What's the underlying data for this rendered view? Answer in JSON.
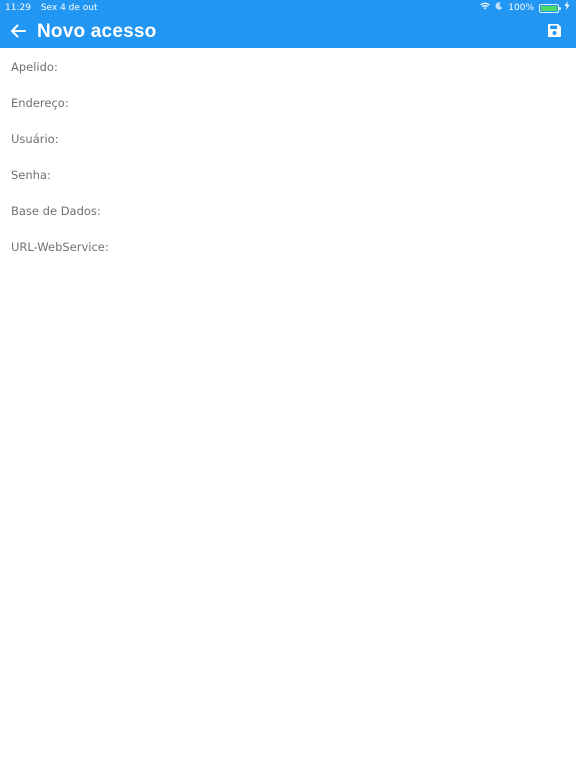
{
  "status_bar": {
    "time": "11:29",
    "date": "Sex 4 de out",
    "battery": "100%",
    "battery_level": 1.0,
    "icons": [
      "wifi-icon",
      "moon-icon",
      "battery-icon",
      "charging-icon"
    ]
  },
  "header": {
    "title": "Novo acesso",
    "back_icon": "arrow-left-icon",
    "save_icon": "save-icon"
  },
  "form": {
    "fields": [
      {
        "label": "Apelido:",
        "value": ""
      },
      {
        "label": "Endereço:",
        "value": ""
      },
      {
        "label": "Usuário:",
        "value": ""
      },
      {
        "label": "Senha:",
        "value": ""
      },
      {
        "label": "Base de Dados:",
        "value": ""
      },
      {
        "label": "URL-WebService:",
        "value": ""
      }
    ]
  },
  "colors": {
    "primary": "#2196f3",
    "background": "#ffffff",
    "label": "#707070",
    "battery": "#4cd964"
  }
}
